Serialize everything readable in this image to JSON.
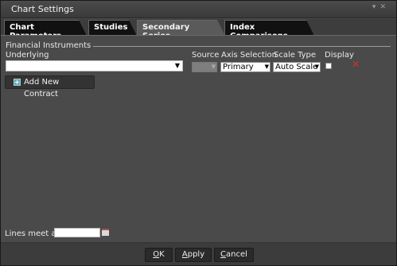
{
  "window": {
    "title": "Chart Settings"
  },
  "tabs": [
    {
      "label": "Chart Parameters",
      "active": false
    },
    {
      "label": "Studies",
      "active": false
    },
    {
      "label": "Secondary Series",
      "active": true
    },
    {
      "label": "Index Comparisons",
      "active": false
    }
  ],
  "group": {
    "title": "Financial Instruments"
  },
  "columns": {
    "underlying": "Underlying",
    "source": "Source",
    "axis_selection": "Axis Selection",
    "scale_type": "Scale Type",
    "display": "Display"
  },
  "row": {
    "underlying_value": "",
    "source_value": "",
    "axis_value": "Primary",
    "scale_value": "Auto Scale",
    "display_checked": false
  },
  "add_contract": {
    "label": "Add New Contract",
    "icon": "add-contract-icon"
  },
  "lines_meet": {
    "label": "Lines meet at",
    "value": ""
  },
  "footer": {
    "ok_key": "O",
    "ok_rest": "K",
    "apply_key": "A",
    "apply_rest": "pply",
    "cancel_key": "C",
    "cancel_rest": "ancel"
  },
  "colors": {
    "delete": "#c83232",
    "active_tab": "#5a5a5a",
    "inactive_tab": "#111111"
  }
}
